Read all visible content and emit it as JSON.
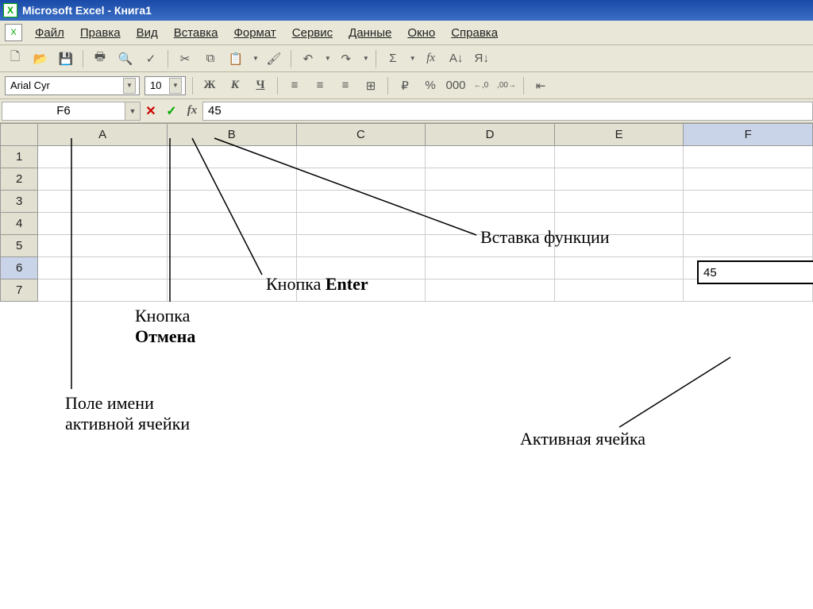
{
  "titlebar": {
    "title": "Microsoft Excel - Книга1"
  },
  "menu": {
    "file": "Файл",
    "edit": "Правка",
    "view": "Вид",
    "insert": "Вставка",
    "format": "Формат",
    "tools": "Сервис",
    "data": "Данные",
    "window": "Окно",
    "help": "Справка"
  },
  "toolbar_icons": {
    "new": "🗋",
    "open": "📂",
    "save": "💾",
    "print": "🖶",
    "preview": "🔍",
    "spell": "✓",
    "cut": "✂",
    "copy": "⧉",
    "paste": "📋",
    "fmtpaint": "🖌",
    "undo": "↶",
    "redo": "↷",
    "sum": "Σ",
    "fx": "fx",
    "sortasc": "A↓",
    "sortdesc": "Я↓"
  },
  "format": {
    "font_name": "Arial Cyr",
    "font_size": "10",
    "bold": "Ж",
    "italic": "К",
    "underline": "Ч",
    "currency": "₽",
    "percent": "%",
    "thousands": "000",
    "inc_dec": "←,0",
    "dec_dec": ",00→"
  },
  "formula_bar": {
    "name_box": "F6",
    "cancel": "✕",
    "enter": "✓",
    "fx": "fx",
    "value": "45"
  },
  "grid": {
    "columns": [
      "A",
      "B",
      "C",
      "D",
      "E",
      "F"
    ],
    "rows": [
      "1",
      "2",
      "3",
      "4",
      "5",
      "6",
      "7"
    ],
    "active_col": "F",
    "active_row": "6",
    "active_value": "45"
  },
  "annotations": {
    "name_box": "Поле имени\nактивной ячейки",
    "cancel": "Кнопка\nОтмена",
    "enter": "Кнопка Enter",
    "fx": "Вставка функции",
    "active_cell": "Активная ячейка"
  }
}
